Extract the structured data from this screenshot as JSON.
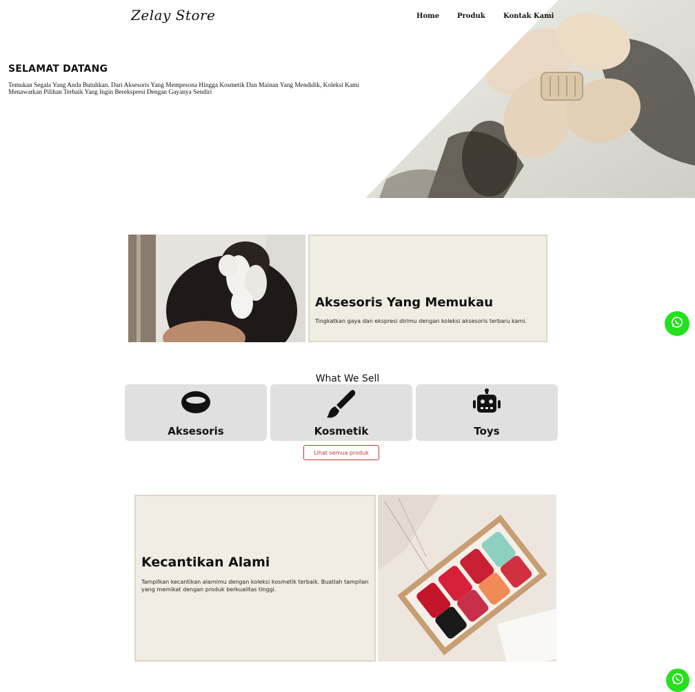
{
  "header": {
    "logo": "Zelay Store",
    "nav": [
      {
        "label": "Home"
      },
      {
        "label": "Produk"
      },
      {
        "label": "Kontak Kami"
      }
    ]
  },
  "hero": {
    "title": "SELAMAT DATANG",
    "text": "Temukan Segala Yang Anda Butuhkan. Dari Aksesoris Yang Mempesona Hingga Kosmetik Dan Mainan Yang Mendidik, Koleksi Kami Menawarkan Pilihan Terbaik Yang Ingin Berekspresi Dengan Gayanya Sendiri",
    "image_icon": "hair-claw-photo"
  },
  "feature_accessories": {
    "title": "Aksesoris Yang Memukau",
    "text": "Tingkatkan gaya dan ekspresi dirimu dengan koleksi aksesoris terbaru kami.",
    "image_icon": "hair-clip-photo"
  },
  "what_we_sell": {
    "title": "What We Sell",
    "categories": [
      {
        "label": "Aksesoris",
        "icon": "ring-icon"
      },
      {
        "label": "Kosmetik",
        "icon": "brush-icon"
      },
      {
        "label": "Toys",
        "icon": "robot-icon"
      }
    ],
    "all_products_button": "Lihat semua produk"
  },
  "feature_beauty": {
    "title": "Kecantikan Alami",
    "text": "Tampilkan kecantikan alamimu dengan koleksi kosmetik terbaik. Buatlah tampilan yang memikat dengan produk berkualitas tinggi.",
    "image_icon": "lipstick-box-photo"
  },
  "colors": {
    "whatsapp": "#25e01e",
    "card_beige": "#f2ede2",
    "category_bg": "#e0e0e0",
    "button_red": "#c0392b"
  }
}
